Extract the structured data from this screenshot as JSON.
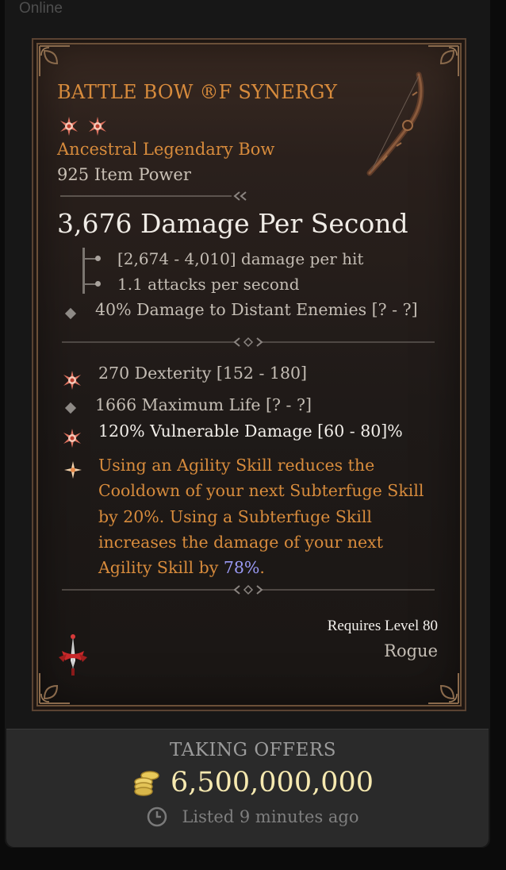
{
  "status": {
    "online_label": "Online"
  },
  "item": {
    "name": "BATTLE BOW ®F SYNERGY",
    "rarity_icon_count": 2,
    "type": "Ancestral Legendary Bow",
    "item_power": "925 Item Power",
    "image_icon": "bow-icon",
    "accent_color": "#d78b3c"
  },
  "weapon": {
    "dps": "3,676 Damage Per Second",
    "damage_per_hit": "[2,674 - 4,010] damage per hit",
    "attack_speed": "1.1 attacks per second",
    "implicit": "40% Damage to Distant Enemies [? - ?]"
  },
  "affixes": [
    {
      "text": "270 Dexterity [152 - 180]",
      "icon": "greater-affix-icon"
    },
    {
      "text": "1666 Maximum Life [? - ?]",
      "icon": "diamond-bullet-icon"
    },
    {
      "text": "120% Vulnerable Damage [60 - 80]%",
      "icon": "greater-affix-icon"
    }
  ],
  "legendary_aspect": {
    "icon": "legendary-aspect-icon",
    "text_before": "Using an Agility Skill reduces the Cooldown of your next Subterfuge Skill by 20%. Using a Subterfuge Skill increases the damage of your next Agility Skill by ",
    "highlight": "78%",
    "text_after": ".",
    "highlight_color": "#9a9af5"
  },
  "requirements": {
    "level": "Requires Level 80",
    "class": "Rogue",
    "class_icon": "rogue-class-icon"
  },
  "listing": {
    "status": "TAKING OFFERS",
    "price": "6,500,000,000",
    "price_icon": "gold-coins-icon",
    "listed": "Listed 9 minutes ago",
    "listed_icon": "clock-icon"
  }
}
